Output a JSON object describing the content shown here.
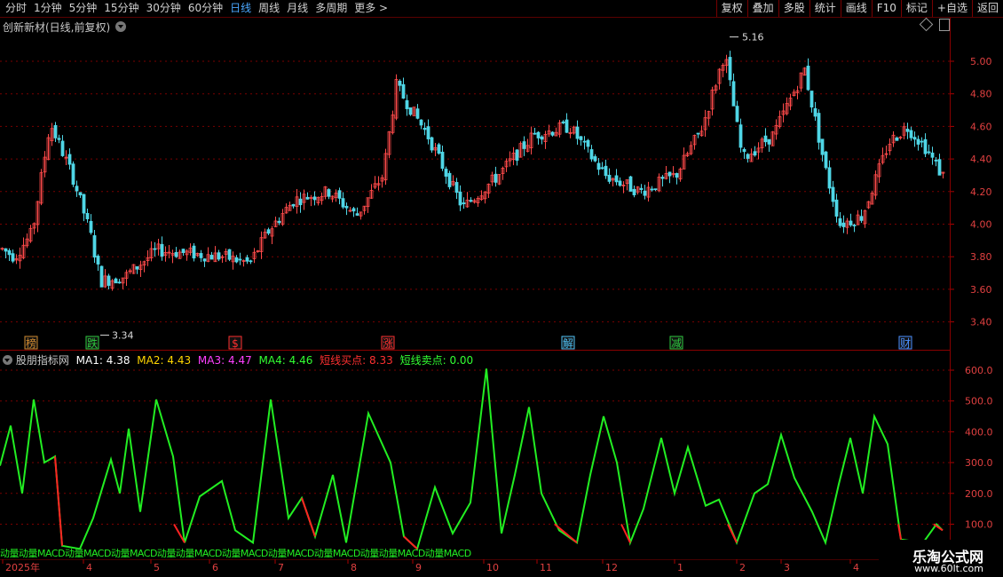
{
  "toolbar": {
    "periods": [
      "分时",
      "1分钟",
      "5分钟",
      "15分钟",
      "30分钟",
      "60分钟",
      "日线",
      "周线",
      "月线",
      "多周期",
      "更多 >"
    ],
    "active_period": "日线",
    "buttons": [
      "复权",
      "叠加",
      "多股",
      "统计",
      "画线",
      "F10",
      "标记",
      "+自选",
      "返回"
    ]
  },
  "main_panel": {
    "title": "创新新材(日线,前复权)",
    "price_ticks": [
      "5.00",
      "4.80",
      "4.60",
      "4.40",
      "4.20",
      "4.00",
      "3.80",
      "3.60",
      "3.40"
    ],
    "high_label": "5.16",
    "low_label": "3.34",
    "event_badges": [
      {
        "label": "榜",
        "color": "#d08a30"
      },
      {
        "label": "跌",
        "color": "#2ecc40"
      },
      {
        "label": "$",
        "color": "#ff3030"
      },
      {
        "label": "涨",
        "color": "#ff3030"
      },
      {
        "label": "解",
        "color": "#4fc3f7"
      },
      {
        "label": "减",
        "color": "#2ecc40"
      },
      {
        "label": "财",
        "color": "#4a90ff"
      }
    ]
  },
  "indicator_panel": {
    "name": "股朋指标网",
    "ma1_label": "MA1:",
    "ma1_value": "4.38",
    "ma2_label": "MA2:",
    "ma2_value": "4.43",
    "ma3_label": "MA3:",
    "ma3_value": "4.47",
    "ma4_label": "MA4:",
    "ma4_value": "4.46",
    "buy_label": "短线买点:",
    "buy_value": "8.33",
    "sell_label": "短线卖点:",
    "sell_value": "0.00",
    "ticks": [
      "600.0",
      "500.0",
      "400.0",
      "300.0",
      "200.0",
      "100.0"
    ],
    "bottom_text": "动量动量MACD动量MACD动量MACD动量动量MACD动量MACD动量MACD动量MACD动量动量MACD动量MACD"
  },
  "time_axis": {
    "labels": [
      "2025年",
      "4",
      "5",
      "6",
      "7",
      "8",
      "9",
      "10",
      "11",
      "12",
      "1",
      "2",
      "3",
      "4"
    ]
  },
  "colors": {
    "up": "#ff4a4a",
    "down": "#4fd6e6",
    "line_green": "#22ee22",
    "line_red": "#ff2222",
    "grid": "#7a0000",
    "ma1": "#ffffff",
    "ma2": "#ffd700",
    "ma3": "#ff40ff",
    "ma4": "#32ff32"
  },
  "watermark": {
    "title": "乐淘公式网",
    "url": "www.60lt.com"
  }
}
